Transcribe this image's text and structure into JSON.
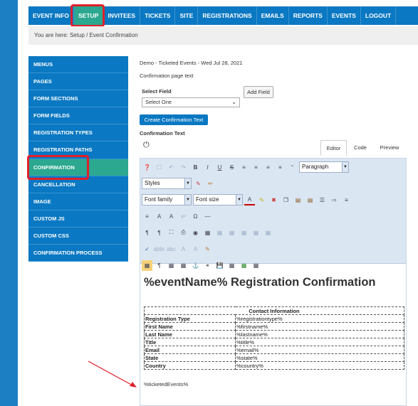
{
  "top_nav": {
    "items": [
      "EVENT INFO",
      "SETUP",
      "INVITEES",
      "TICKETS",
      "SITE",
      "REGISTRATIONS",
      "EMAILS",
      "REPORTS",
      "EVENTS",
      "LOGOUT"
    ]
  },
  "breadcrumb": "You are here:  Setup / Event Confirmation",
  "sidebar": {
    "items": [
      "MENUS",
      "PAGES",
      "FORM SECTIONS",
      "FORM FIELDS",
      "REGISTRATION TYPES",
      "REGISTRATION PATHS",
      "CONFIRMATION",
      "CANCELLATION",
      "IMAGE",
      "CUSTOM JS",
      "CUSTOM CSS",
      "CONFIRMATION PROCESS"
    ]
  },
  "content": {
    "event_line": "Demo - Ticketed Events - Wed Jul 28, 2021",
    "page_text_label": "Confirmation page text",
    "select_field_label": "Select Field",
    "select_value": "Select One",
    "add_field_button": "Add Field",
    "create_button": "Create Confirmation Text",
    "confirmation_text_label": "Confirmation Text",
    "tabs": [
      "Editor",
      "Code",
      "Preview"
    ]
  },
  "editor": {
    "paragraph_dd": "Paragraph",
    "styles_dd": "Styles",
    "font_family_dd": "Font family",
    "font_size_dd": "Font size",
    "heading": "%eventName% Registration Confirmation",
    "table_header": "Contact Information",
    "rows": [
      {
        "label": "Registration Type",
        "value": "%registrationtype%"
      },
      {
        "label": "First Name",
        "value": "%firstname%"
      },
      {
        "label": "Last Name",
        "value": "%lastname%"
      },
      {
        "label": "Title",
        "value": "%title%"
      },
      {
        "label": "Email",
        "value": "%email%"
      },
      {
        "label": "State",
        "value": "%state%"
      },
      {
        "label": "Country",
        "value": "%country%"
      }
    ],
    "tickets_placeholder": "%ticketedEvents%"
  },
  "colors": {
    "nav_blue": "#0a78c2",
    "active_green": "#2ba88f",
    "highlight_red": "#e0202a"
  }
}
